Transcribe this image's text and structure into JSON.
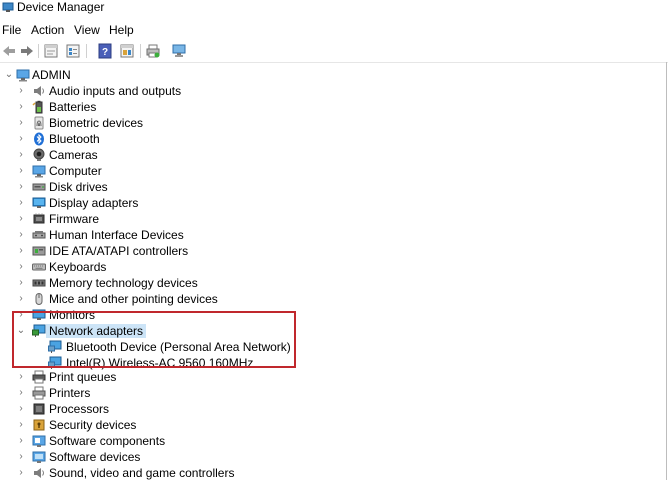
{
  "window": {
    "title": "Device Manager"
  },
  "menu": [
    "File",
    "Action",
    "View",
    "Help"
  ],
  "toolbar": {
    "buttons": [
      {
        "icon": "back-arrow-icon"
      },
      {
        "icon": "forward-arrow-icon"
      },
      {
        "icon": "properties-icon"
      },
      {
        "icon": "device-list-icon"
      },
      {
        "icon": "help-icon"
      },
      {
        "icon": "view-resources-icon"
      },
      {
        "icon": "print-icon"
      },
      {
        "icon": "scan-hardware-icon"
      }
    ]
  },
  "tree": {
    "root": "ADMIN",
    "categories": [
      {
        "label": "Audio inputs and outputs",
        "icon": "speaker-icon"
      },
      {
        "label": "Batteries",
        "icon": "battery-icon"
      },
      {
        "label": "Biometric devices",
        "icon": "fingerprint-icon"
      },
      {
        "label": "Bluetooth",
        "icon": "bluetooth-icon"
      },
      {
        "label": "Cameras",
        "icon": "camera-icon"
      },
      {
        "label": "Computer",
        "icon": "computer-icon"
      },
      {
        "label": "Disk drives",
        "icon": "disk-drive-icon"
      },
      {
        "label": "Display adapters",
        "icon": "display-adapter-icon"
      },
      {
        "label": "Firmware",
        "icon": "firmware-icon"
      },
      {
        "label": "Human Interface Devices",
        "icon": "hid-icon"
      },
      {
        "label": "IDE ATA/ATAPI controllers",
        "icon": "ide-controller-icon"
      },
      {
        "label": "Keyboards",
        "icon": "keyboard-icon"
      },
      {
        "label": "Memory technology devices",
        "icon": "memory-icon"
      },
      {
        "label": "Mice and other pointing devices",
        "icon": "mouse-icon"
      },
      {
        "label": "Monitors",
        "icon": "monitor-icon"
      },
      {
        "label": "Network adapters",
        "icon": "network-adapter-icon",
        "expanded": true,
        "children": [
          {
            "label": "Bluetooth Device (Personal Area Network)",
            "icon": "network-adapter-icon"
          },
          {
            "label": "Intel(R) Wireless-AC 9560 160MHz",
            "icon": "network-adapter-icon"
          }
        ]
      },
      {
        "label": "Print queues",
        "icon": "print-queue-icon"
      },
      {
        "label": "Printers",
        "icon": "printer-icon"
      },
      {
        "label": "Processors",
        "icon": "processor-icon"
      },
      {
        "label": "Security devices",
        "icon": "security-icon"
      },
      {
        "label": "Software components",
        "icon": "software-component-icon"
      },
      {
        "label": "Software devices",
        "icon": "software-device-icon"
      },
      {
        "label": "Sound, video and game controllers",
        "icon": "sound-controller-icon"
      }
    ]
  },
  "colors": {
    "selection": "#cce4f7",
    "highlight_border": "#c0282d",
    "accent": "#0078d4"
  }
}
